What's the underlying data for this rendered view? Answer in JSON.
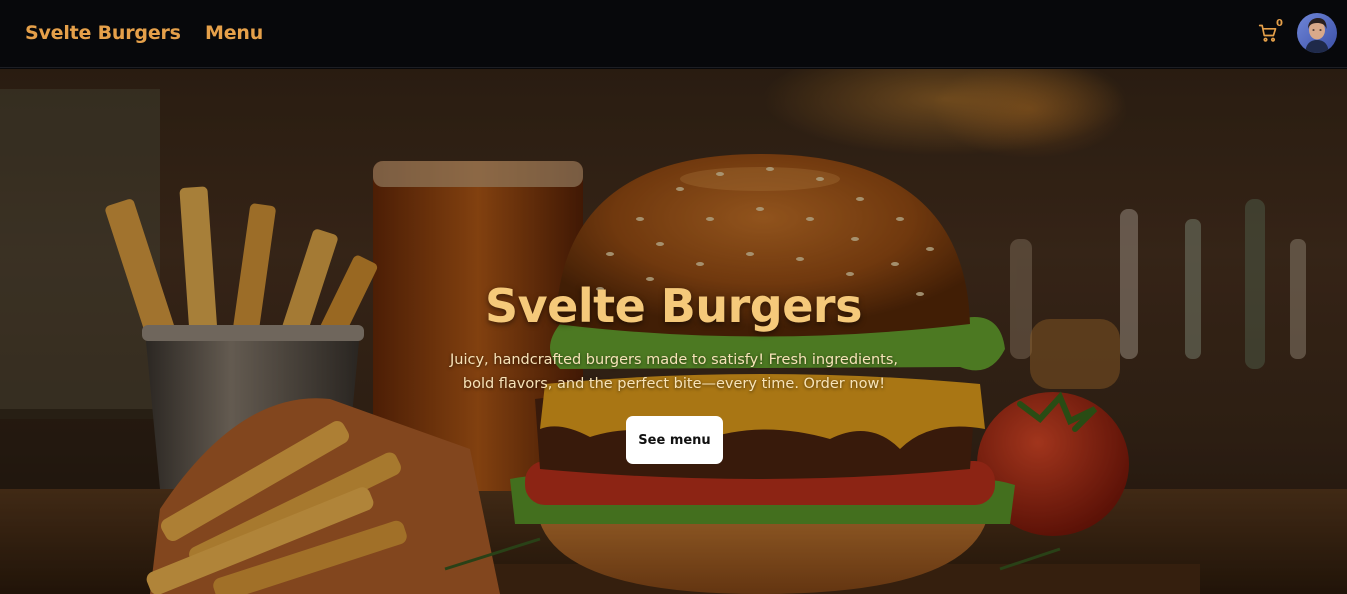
{
  "nav": {
    "brand": "Svelte Burgers",
    "links": [
      {
        "label": "Menu"
      }
    ],
    "cart": {
      "count": "0",
      "icon": "cart-icon"
    },
    "avatar": {
      "icon": "user-avatar"
    }
  },
  "hero": {
    "title": "Svelte Burgers",
    "description": "Juicy, handcrafted burgers made to satisfy! Fresh ingredients, bold flavors, and the perfect bite—every time. Order now!",
    "cta_label": "See menu"
  },
  "colors": {
    "accent": "#e5a04a",
    "nav_bg": "#07080b",
    "hero_title": "#f5c97a",
    "button_bg": "#ffffff"
  }
}
